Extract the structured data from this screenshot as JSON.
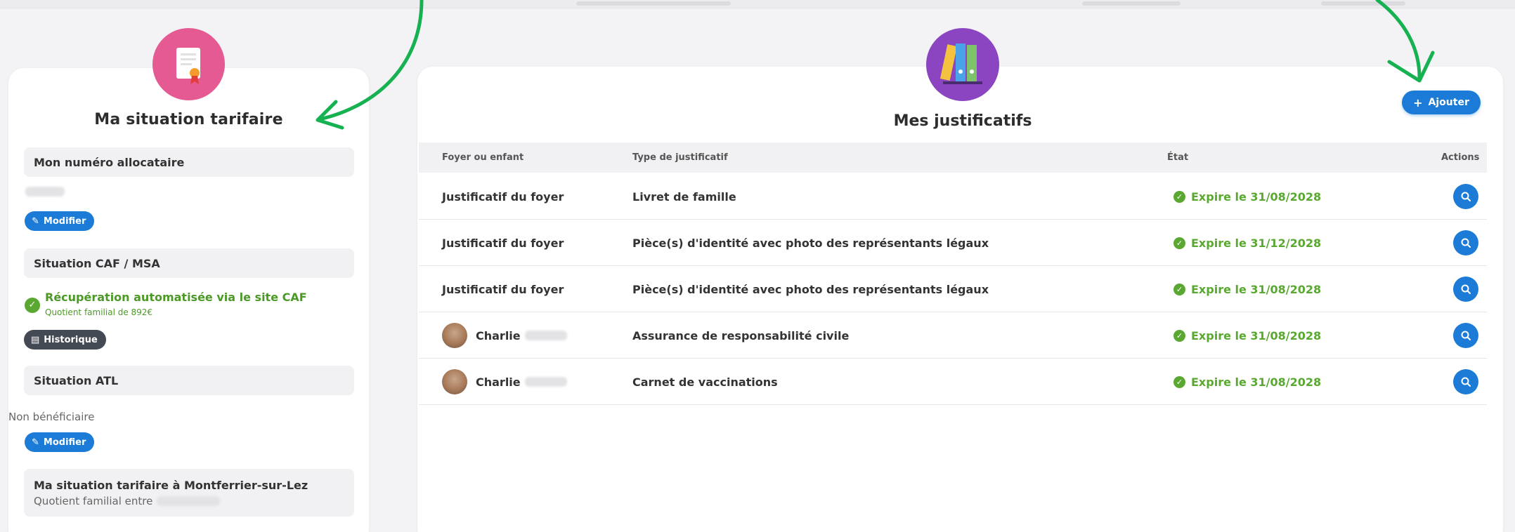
{
  "left": {
    "title": "Ma situation tarifaire",
    "allocataire_heading": "Mon numéro allocataire",
    "modify_label": "Modifier",
    "caf_heading": "Situation CAF / MSA",
    "caf_status": "Récupération automatisée via le site CAF",
    "caf_quotient": "Quotient familial de 892€",
    "history_label": "Historique",
    "atl_heading": "Situation ATL",
    "atl_status": "Non bénéficiaire",
    "modify_label_2": "Modifier",
    "montferrier_heading": "Ma situation tarifaire à Montferrier-sur-Lez",
    "montferrier_quotient": "Quotient familial entre"
  },
  "right": {
    "title": "Mes justificatifs",
    "add_label": "Ajouter",
    "columns": [
      "Foyer ou enfant",
      "Type de justificatif",
      "État",
      "Actions"
    ],
    "rows": [
      {
        "owner": "Justificatif du foyer",
        "type": "Livret de famille",
        "state": "Expire le 31/08/2028"
      },
      {
        "owner": "Justificatif du foyer",
        "type": "Pièce(s) d'identité avec photo des représentants légaux",
        "state": "Expire le 31/12/2028"
      },
      {
        "owner": "Justificatif du foyer",
        "type": "Pièce(s) d'identité avec photo des représentants légaux",
        "state": "Expire le 31/08/2028"
      },
      {
        "owner": "Charlie",
        "type": "Assurance de responsabilité civile",
        "state": "Expire le 31/08/2028"
      },
      {
        "owner": "Charlie",
        "type": "Carnet de vaccinations",
        "state": "Expire le 31/08/2028"
      }
    ]
  },
  "colors": {
    "accent_blue": "#1b7bd6",
    "success_green": "#5aa832",
    "annotation_green": "#16b150",
    "icon_pink": "#e55a93",
    "icon_purple": "#8c45c0"
  }
}
